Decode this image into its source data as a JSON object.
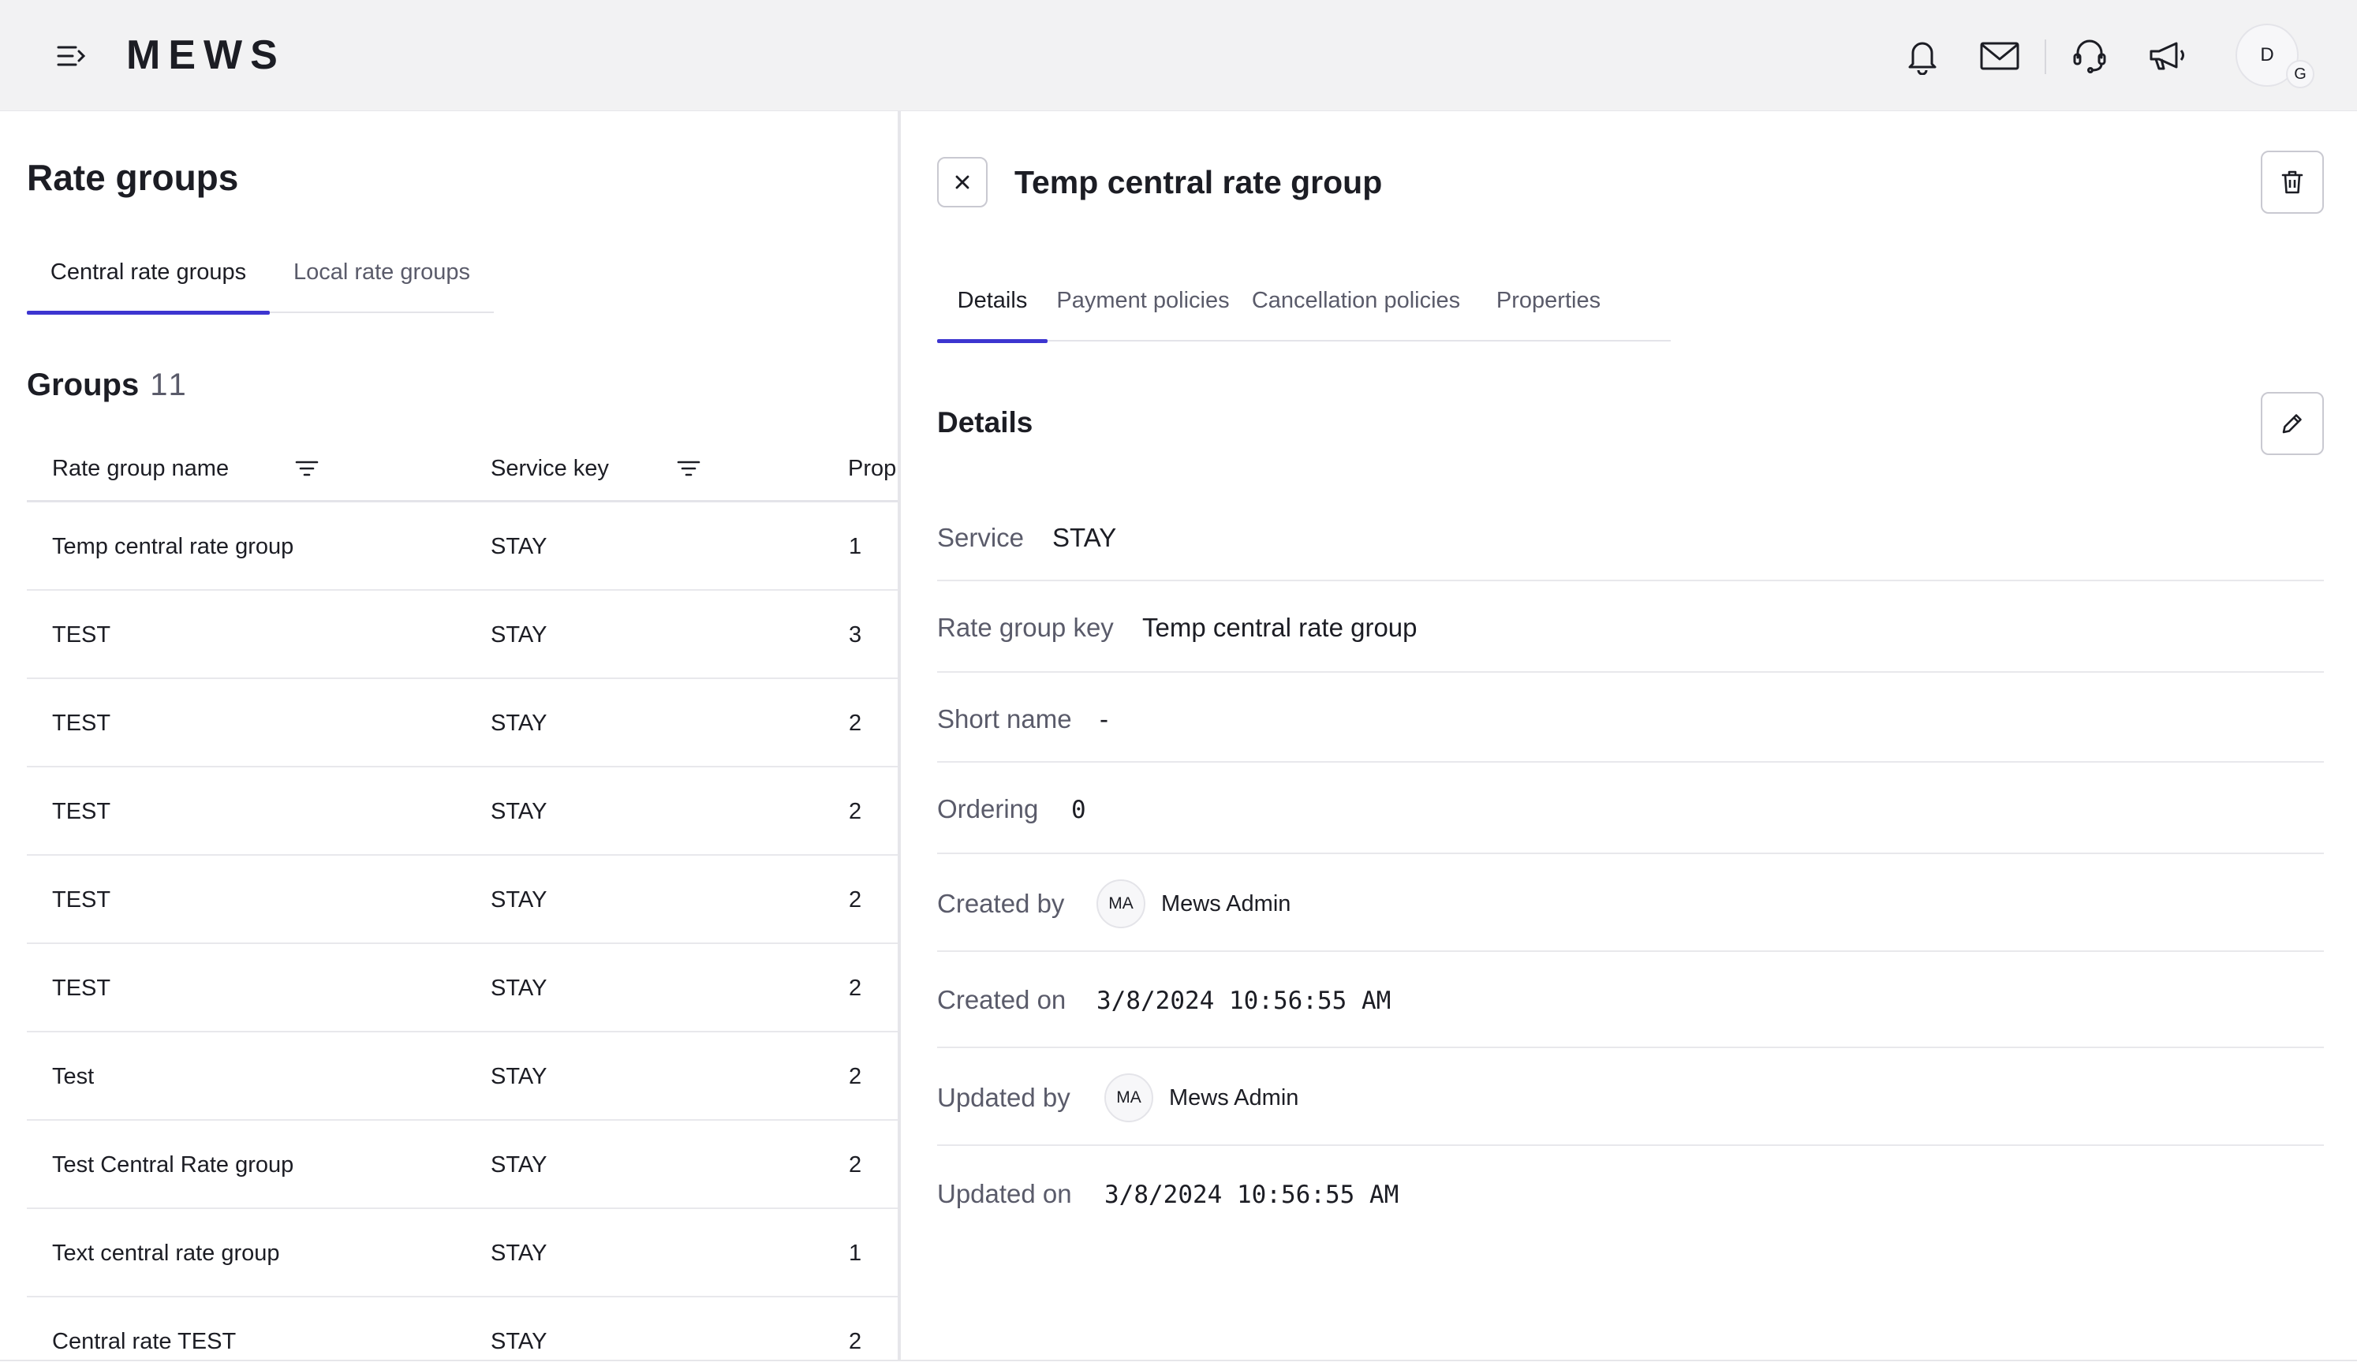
{
  "header": {
    "logo": "MEWS",
    "avatar_initial": "D",
    "avatar_sub_initial": "G",
    "icons": [
      "menu-icon",
      "bell-icon",
      "mail-icon",
      "support-icon",
      "megaphone-icon"
    ]
  },
  "left": {
    "title": "Rate groups",
    "tabs": [
      {
        "label": "Central rate groups",
        "active": true
      },
      {
        "label": "Local rate groups",
        "active": false
      }
    ],
    "groups_label": "Groups",
    "groups_count": "11",
    "columns": [
      "Rate group name",
      "Service key",
      "Prop"
    ],
    "rows": [
      {
        "name": "Temp central rate group",
        "service": "STAY",
        "prop": "1"
      },
      {
        "name": "TEST",
        "service": "STAY",
        "prop": "3"
      },
      {
        "name": "TEST",
        "service": "STAY",
        "prop": "2"
      },
      {
        "name": "TEST",
        "service": "STAY",
        "prop": "2"
      },
      {
        "name": "TEST",
        "service": "STAY",
        "prop": "2"
      },
      {
        "name": "TEST",
        "service": "STAY",
        "prop": "2"
      },
      {
        "name": "Test",
        "service": "STAY",
        "prop": "2"
      },
      {
        "name": "Test Central Rate group",
        "service": "STAY",
        "prop": "2"
      },
      {
        "name": "Text central rate group",
        "service": "STAY",
        "prop": "1"
      },
      {
        "name": "Central rate TEST",
        "service": "STAY",
        "prop": "2"
      }
    ]
  },
  "right": {
    "title": "Temp central rate group",
    "tabs": [
      {
        "label": "Details",
        "active": true
      },
      {
        "label": "Payment policies",
        "active": false
      },
      {
        "label": "Cancellation policies",
        "active": false
      },
      {
        "label": "Properties",
        "active": false
      }
    ],
    "section_title": "Details",
    "fields": {
      "service": {
        "label": "Service",
        "value": "STAY"
      },
      "rate_group_key": {
        "label": "Rate group key",
        "value": "Temp central rate group"
      },
      "short_name": {
        "label": "Short name",
        "value": "-"
      },
      "ordering": {
        "label": "Ordering",
        "value": "0"
      },
      "created_by": {
        "label": "Created by",
        "initials": "MA",
        "name": "Mews Admin"
      },
      "created_on": {
        "label": "Created on",
        "value": "3/8/2024 10:56:55 AM"
      },
      "updated_by": {
        "label": "Updated by",
        "initials": "MA",
        "name": "Mews Admin"
      },
      "updated_on": {
        "label": "Updated on",
        "value": "3/8/2024 10:56:55 AM"
      }
    }
  },
  "colors": {
    "accent": "#3d35d0",
    "header_bg": "#f2f2f3",
    "text": "#1c1d24",
    "muted": "#5a5b6a"
  }
}
